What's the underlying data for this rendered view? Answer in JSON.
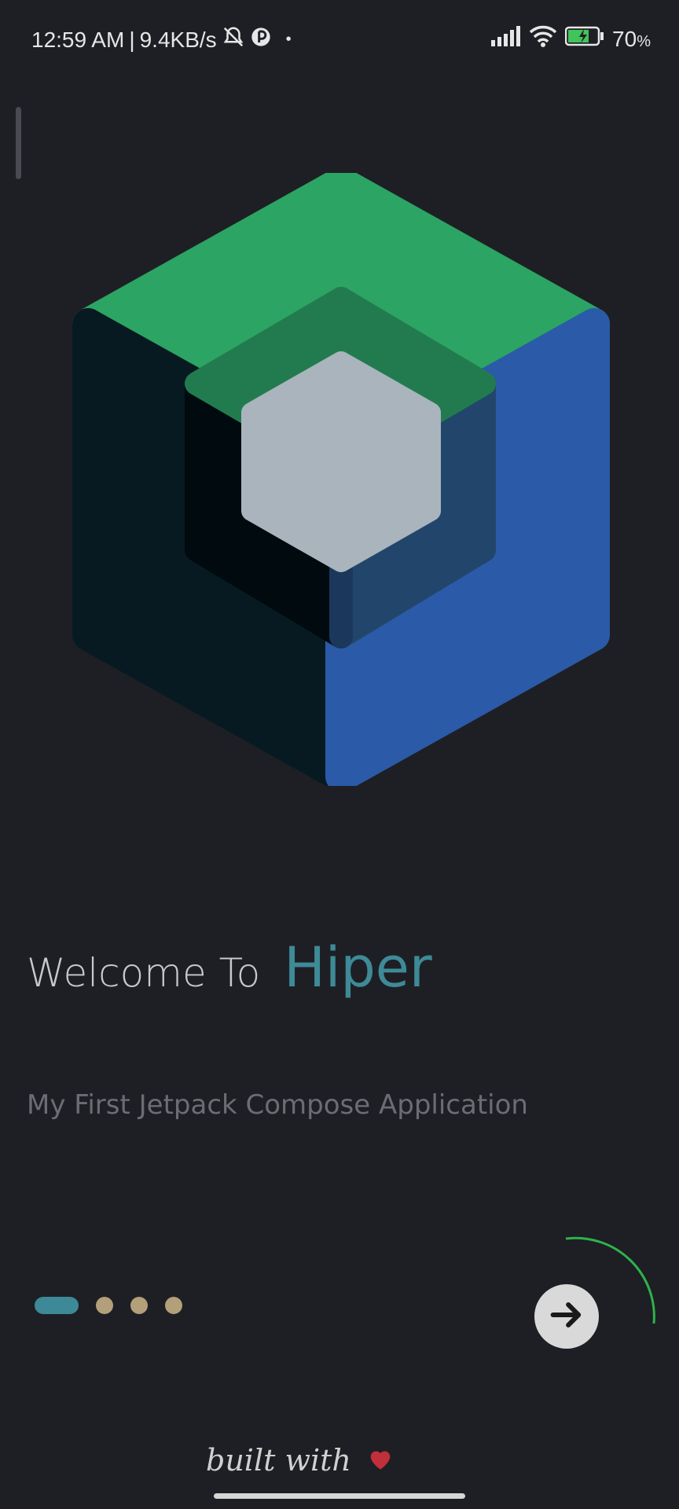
{
  "status_bar": {
    "time": "12:59 AM",
    "separator": "|",
    "net_speed": "9.4KB/s",
    "battery_percent": "70",
    "battery_unit": "%",
    "icons": [
      "mute-bell-icon",
      "app-notification-icon",
      "signal-icon",
      "wifi-icon",
      "battery-charging-icon"
    ]
  },
  "welcome": {
    "prefix": "Welcome To",
    "app_name": "Hiper"
  },
  "subtitle": "My First Jetpack Compose Application",
  "pager": {
    "page_count": 4,
    "current_page": 1,
    "progress_arc_color": "#2db34a"
  },
  "next_button": {
    "icon": "arrow-right-icon"
  },
  "footer": {
    "text": "built with",
    "icon": "heart-icon",
    "heart_color": "#c0303a"
  },
  "colors": {
    "background": "#1e1f24",
    "accent": "#3e8a97",
    "dot_inactive": "#b39f7a",
    "logo_green": "#2ca463",
    "logo_blue": "#2b5aa8",
    "logo_dark": "#071a22"
  }
}
